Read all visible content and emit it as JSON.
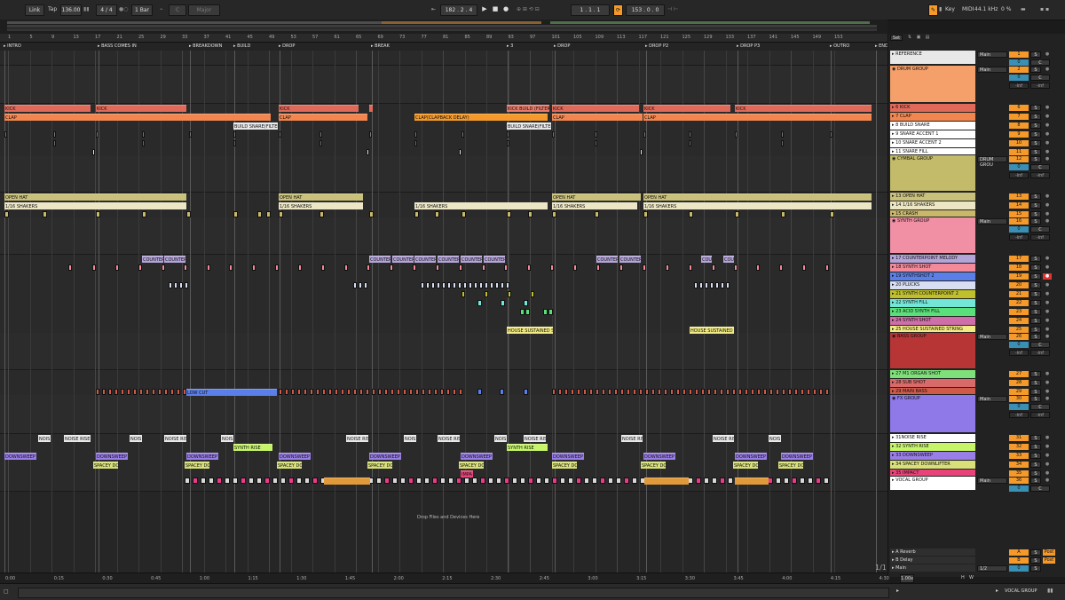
{
  "transport": {
    "link": "Link",
    "tap": "Tap",
    "tempo": "136.00",
    "time_sig": "4 / 4",
    "quantize": "1 Bar",
    "key_placeholder": "C",
    "scale": "Major",
    "position": "182 .   2 .   4",
    "loop_start": "1 .   1 .   1",
    "loop_length": "153 .   0 .   0",
    "key_label": "Key",
    "midi_label": "MIDI",
    "sample_rate": "44.1 kHz",
    "cpu": "0 %"
  },
  "ruler": [
    "1",
    "5",
    "9",
    "13",
    "17",
    "21",
    "25",
    "29",
    "33",
    "37",
    "41",
    "45",
    "49",
    "53",
    "57",
    "61",
    "65",
    "69",
    "73",
    "77",
    "81",
    "85",
    "89",
    "93",
    "97",
    "101",
    "105",
    "109",
    "113",
    "117",
    "121",
    "125",
    "129",
    "133",
    "137",
    "141",
    "145",
    "149",
    "153"
  ],
  "locators": [
    "INTRO",
    "BASS COMES IN",
    "BREAKDOWN",
    "BUILD",
    "DROP",
    "BREAK",
    "3",
    "DROP",
    "DROP P2",
    "DROP P3",
    "OUTRO",
    "END"
  ],
  "time_ruler": [
    "0:00",
    "0:15",
    "0:30",
    "0:45",
    "1:00",
    "1:15",
    "1:30",
    "1:45",
    "2:00",
    "2:15",
    "2:30",
    "2:45",
    "3:00",
    "3:15",
    "3:30",
    "3:45",
    "4:00",
    "4:15",
    "4:30"
  ],
  "clips": {
    "kick": "KICK",
    "kick_build": "KICK BUILD (FILTER)",
    "clap": "CLAP",
    "clap_delay": "CLAP(CLAPBACK DELAY)",
    "build_snare": "BUILD SNARE(FILTER)",
    "open_hat": "OPEN HAT",
    "shakers": "1/16 SHAKERS",
    "counter": "COUNTER",
    "counter_short": "COU",
    "house_sustained": "HOUSE SUSTAINED ST",
    "low_cut": "LOW CUT",
    "noise": "NOIS",
    "noise_rise": "NOISE RISE",
    "synth_rise": "SYNTH RISE",
    "downsweep": "DOWNSWEEP",
    "spacey": "SPACEY DO",
    "impact": "IMPA",
    "drop_hint": "Drop Files and Devices Here",
    "zoom": "1/1"
  },
  "mixer": {
    "set_label": "Set",
    "main": "Main",
    "drum_group_route": "DRUM GROU",
    "inf": "-inf",
    "s_label": "S",
    "c_label": "C",
    "post": "Post",
    "half": "1/2",
    "tracks": [
      {
        "name": "REFERENCE",
        "num": "1",
        "color": "#e8e8e8"
      },
      {
        "name": "DRUM GROUP",
        "num": "2",
        "color": "#f5a06a"
      },
      {
        "name": "6 KICK",
        "num": "6",
        "color": "#e06a5a"
      },
      {
        "name": "7 CLAP",
        "num": "7",
        "color": "#f3864f"
      },
      {
        "name": "8 BUILD SNARE",
        "num": "8",
        "color": "#ffffff"
      },
      {
        "name": "9 SNARE ACCENT 1",
        "num": "9",
        "color": "#ffffff"
      },
      {
        "name": "10 SNARE ACCENT 2",
        "num": "10",
        "color": "#ffffff"
      },
      {
        "name": "11 SNARE FILL",
        "num": "11",
        "color": "#ffffff"
      },
      {
        "name": "CYMBAL GROUP",
        "num": "12",
        "color": "#c3bb6a"
      },
      {
        "name": "13 OPEN HAT",
        "num": "13",
        "color": "#c9c07a"
      },
      {
        "name": "14 1/16 SHAKERS",
        "num": "14",
        "color": "#ece6c4"
      },
      {
        "name": "15 CRASH",
        "num": "15",
        "color": "#c9b86a"
      },
      {
        "name": "SYNTH GROUP",
        "num": "16",
        "color": "#f18fa5"
      },
      {
        "name": "17 COUNTERPOINT MELODY",
        "num": "17",
        "color": "#b4a5d8"
      },
      {
        "name": "18 SYNTH SHOT",
        "num": "18",
        "color": "#f28a9a"
      },
      {
        "name": "19 SYNTHSHOT 2",
        "num": "19",
        "color": "#5b7fe8"
      },
      {
        "name": "20 PLUCKS",
        "num": "20",
        "color": "#d8dff2"
      },
      {
        "name": "21 SYNTH COUNTERPOINT 2",
        "num": "21",
        "color": "#bfc02b"
      },
      {
        "name": "22 SYNTH FILL",
        "num": "22",
        "color": "#73e6d8"
      },
      {
        "name": "23 ACID SYNTH FILL",
        "num": "23",
        "color": "#5ae07a"
      },
      {
        "name": "24 SYNTH SHOT",
        "num": "24",
        "color": "#cf6fa9"
      },
      {
        "name": "25 HOUSE SUSTAINED STRING",
        "num": "25",
        "color": "#f2ea82"
      },
      {
        "name": "BASS GROUP",
        "num": "26",
        "color": "#b83535"
      },
      {
        "name": "27 M1 ORGAN SHOT",
        "num": "27",
        "color": "#7fe07a"
      },
      {
        "name": "28 SUB SHOT",
        "num": "28",
        "color": "#d86a6a"
      },
      {
        "name": "29 MAIN BASS",
        "num": "29",
        "color": "#d05a4a"
      },
      {
        "name": "FX GROUP",
        "num": "30",
        "color": "#8f78e8"
      },
      {
        "name": "31NOISE RISE",
        "num": "31",
        "color": "#ffffff"
      },
      {
        "name": "32 SYNTH RISE",
        "num": "32",
        "color": "#c7f56a"
      },
      {
        "name": "33 DOWNSWEEP",
        "num": "33",
        "color": "#9a7ee8"
      },
      {
        "name": "34 SPACEY DOWNLIFTER",
        "num": "34",
        "color": "#d9e07a"
      },
      {
        "name": "35 IMPACT",
        "num": "35",
        "color": "#e8447a"
      },
      {
        "name": "VOCAL GROUP",
        "num": "36",
        "color": "#ffffff"
      }
    ],
    "returns": [
      {
        "name": "A Reverb",
        "num": "A"
      },
      {
        "name": "B Delay",
        "num": "B"
      },
      {
        "name": "Main",
        "num": "M"
      }
    ]
  },
  "status": {
    "selected_track": "VOCAL GROUP",
    "view_h": "H",
    "view_w": "W",
    "zoom_pct": "1.00x"
  }
}
